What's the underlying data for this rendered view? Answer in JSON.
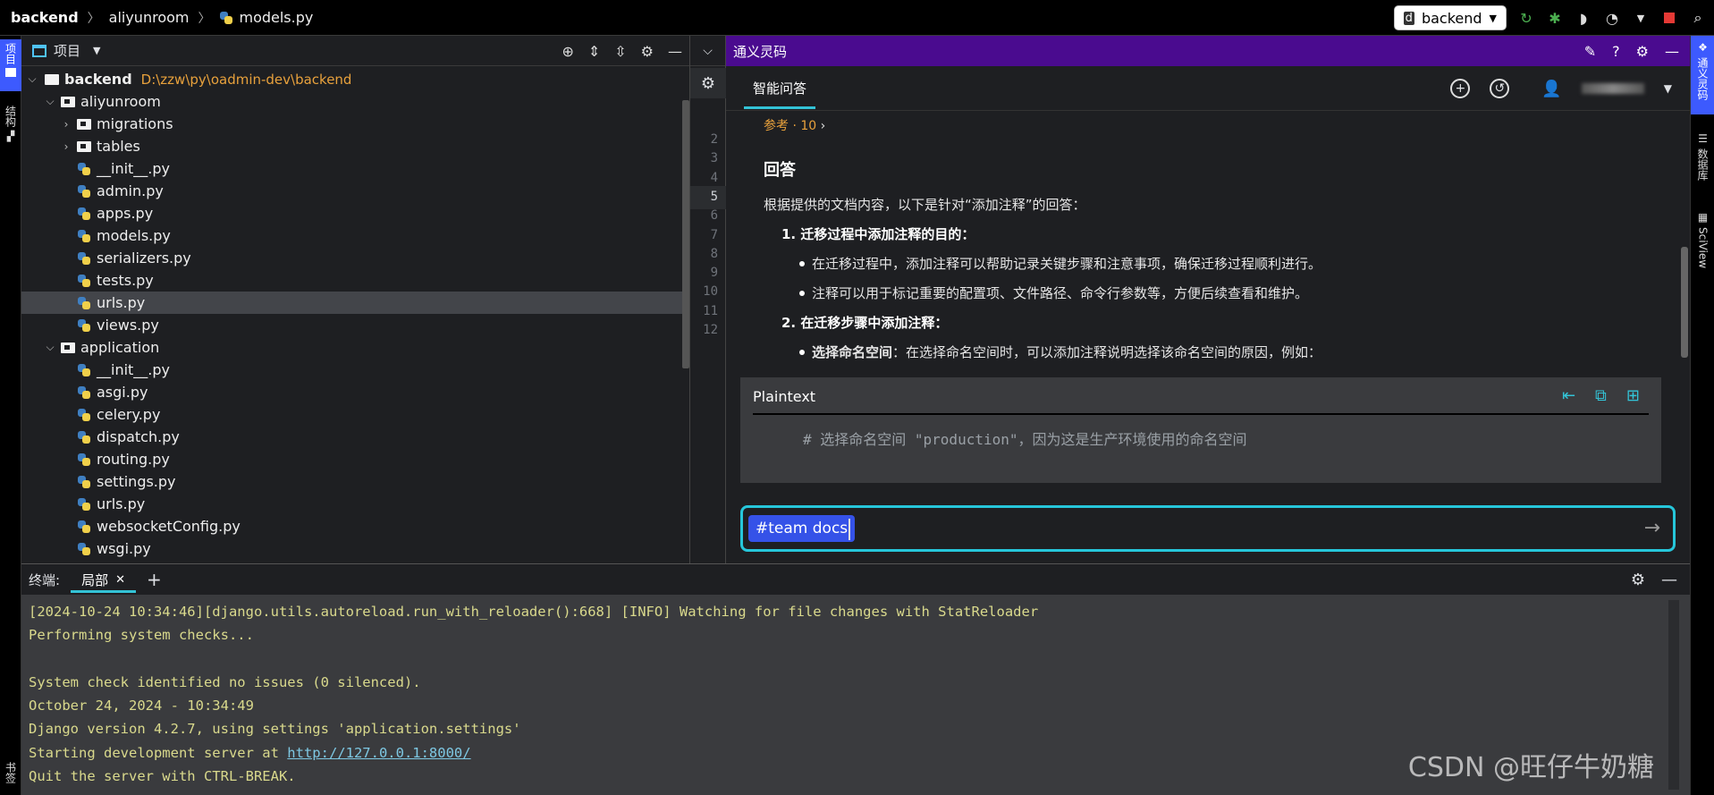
{
  "breadcrumb": {
    "project": "backend",
    "folder": "aliyunroom",
    "file": "models.py"
  },
  "topbar": {
    "branch": "backend"
  },
  "left_strip": {
    "project_tab": "项目",
    "structure_tab": "结构",
    "bottom_tab": "书签"
  },
  "project_panel": {
    "title": "项目",
    "root": {
      "name": "backend",
      "path": "D:\\zzw\\py\\oadmin-dev\\backend"
    },
    "tree": [
      {
        "label": "aliyunroom",
        "type": "folder",
        "depth": 1,
        "expanded": true
      },
      {
        "label": "migrations",
        "type": "folder",
        "depth": 2,
        "expanded": false
      },
      {
        "label": "tables",
        "type": "folder",
        "depth": 2,
        "expanded": false
      },
      {
        "label": "__init__.py",
        "type": "py",
        "depth": 3
      },
      {
        "label": "admin.py",
        "type": "py",
        "depth": 3
      },
      {
        "label": "apps.py",
        "type": "py",
        "depth": 3
      },
      {
        "label": "models.py",
        "type": "py",
        "depth": 3
      },
      {
        "label": "serializers.py",
        "type": "py",
        "depth": 3
      },
      {
        "label": "tests.py",
        "type": "py",
        "depth": 3
      },
      {
        "label": "urls.py",
        "type": "py",
        "depth": 3,
        "selected": true
      },
      {
        "label": "views.py",
        "type": "py",
        "depth": 3
      },
      {
        "label": "application",
        "type": "folder",
        "depth": 1,
        "expanded": true
      },
      {
        "label": "__init__.py",
        "type": "py",
        "depth": 3
      },
      {
        "label": "asgi.py",
        "type": "py",
        "depth": 3
      },
      {
        "label": "celery.py",
        "type": "py",
        "depth": 3
      },
      {
        "label": "dispatch.py",
        "type": "py",
        "depth": 3
      },
      {
        "label": "routing.py",
        "type": "py",
        "depth": 3
      },
      {
        "label": "settings.py",
        "type": "py",
        "depth": 3
      },
      {
        "label": "urls.py",
        "type": "py",
        "depth": 3
      },
      {
        "label": "websocketConfig.py",
        "type": "py",
        "depth": 3
      },
      {
        "label": "wsgi.py",
        "type": "py",
        "depth": 3
      }
    ]
  },
  "gutter": {
    "lines": [
      "2",
      "3",
      "4",
      "5",
      "6",
      "7",
      "8",
      "9",
      "10",
      "11",
      "12"
    ],
    "current": "5"
  },
  "tongyi": {
    "title": "通义灵码",
    "tab": "智能问答",
    "ref": "参考 · 10",
    "answer_heading": "回答",
    "intro": "根据提供的文档内容，以下是针对“添加注释”的回答：",
    "item1_title": "1. 迁移过程中添加注释的目的：",
    "item1_bullets": [
      "在迁移过程中，添加注释可以帮助记录关键步骤和注意事项，确保迁移过程顺利进行。",
      "注释可以用于标记重要的配置项、文件路径、命令行参数等，方便后续查看和维护。"
    ],
    "item2_title": "2. 在迁移步骤中添加注释：",
    "item2_bullet_bold": "选择命名空间",
    "item2_bullet_rest": "：在选择命名空间时，可以添加注释说明选择该命名空间的原因，例如：",
    "code_lang": "Plaintext",
    "code_line": "# 选择命名空间 \"production\"，因为这是生产环境使用的命名空间",
    "input_tag": "#team docs"
  },
  "right_strip": {
    "tongyi_tab": "通义灵码",
    "db_tab": "数据库",
    "sciview_tab": "SciView"
  },
  "terminal": {
    "label": "终端:",
    "tab": "局部",
    "lines": [
      "[2024-10-24 10:34:46][django.utils.autoreload.run_with_reloader():668] [INFO] Watching for file changes with StatReloader",
      "Performing system checks...",
      "",
      "System check identified no issues (0 silenced).",
      "October 24, 2024 - 10:34:49",
      "Django version 4.2.7, using settings 'application.settings'"
    ],
    "server_prefix": "Starting development server at ",
    "server_url": "http://127.0.0.1:8000/",
    "quit_line": "Quit the server with CTRL-BREAK."
  },
  "watermark": "CSDN @旺仔牛奶糖"
}
